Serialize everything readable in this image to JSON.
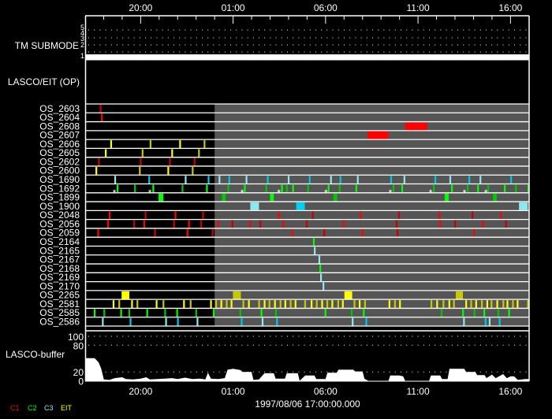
{
  "chart_data": {
    "type": "timeline",
    "title": "",
    "date_label": "1997/08/06 17:00:00.000",
    "x_range_hours": [
      0,
      24
    ],
    "x_ticks": [
      {
        "hour": 3,
        "label": "20:00"
      },
      {
        "hour": 8,
        "label": "01:00"
      },
      {
        "hour": 13,
        "label": "06:00"
      },
      {
        "hour": 18,
        "label": "11:00"
      },
      {
        "hour": 23,
        "label": "16:00"
      }
    ],
    "shaded_from_hour": 7,
    "tm_submode": {
      "label": "TM SUBMODE",
      "levels": [
        "5",
        "4",
        "3",
        "2",
        "1"
      ],
      "active_level": "1"
    },
    "op_panel_label": "LASCO/EIT (OP)",
    "rows": [
      {
        "name": "OS_2603",
        "colors": [
          "#c80000"
        ],
        "events": [
          0.83
        ]
      },
      {
        "name": "OS_2604",
        "colors": [
          "#ff0000"
        ],
        "events": [
          0.9
        ]
      },
      {
        "name": "OS_2608",
        "colors": [
          "#ff0000"
        ],
        "events": [],
        "blocks": [
          [
            17.3,
            18.5
          ]
        ]
      },
      {
        "name": "OS_2607",
        "colors": [
          "#ff0000"
        ],
        "events": [],
        "blocks": [
          [
            15.27,
            16.4
          ]
        ]
      },
      {
        "name": "OS_2606",
        "colors": [
          "#ffff00",
          "#c8c800"
        ],
        "events": [
          1.4,
          3.53,
          5.13,
          6.45
        ]
      },
      {
        "name": "OS_2605",
        "colors": [
          "#ffff00",
          "#c8c800"
        ],
        "events": [
          1.11,
          3.1,
          4.7,
          6.15
        ]
      },
      {
        "name": "OS_2602",
        "colors": [
          "#c80000"
        ],
        "events": [
          0.74,
          3.0,
          4.58,
          5.91
        ]
      },
      {
        "name": "OS_2600",
        "colors": [
          "#ffff00",
          "#c8c800"
        ],
        "events": [
          0.6,
          2.95,
          4.49,
          5.81
        ]
      },
      {
        "name": "OS_1690",
        "colors": [
          "#8ee8f0",
          "#00c8e8"
        ],
        "events": [
          1.62,
          3.46,
          5.43,
          6.67,
          7.26,
          7.79,
          8.72,
          9.87,
          11.0,
          12.14,
          13.29,
          13.8,
          14.74,
          16.54,
          17.26,
          18.93,
          19.74,
          20.77,
          21.37,
          23.03
        ]
      },
      {
        "name": "OS_1692",
        "colors": [
          "#00ff00",
          "#00c800"
        ],
        "events": [
          1.75,
          2.69,
          3.68,
          5.26,
          6.58,
          7.74,
          8.63,
          9.79,
          10.64,
          10.9,
          11.24,
          12.05,
          13.16,
          13.76,
          14.66,
          16.67,
          17.14,
          18.85,
          19.83,
          20.68,
          21.24,
          21.79,
          22.69,
          23.29,
          23.96
        ],
        "star_label": "*",
        "stars": [
          1.58,
          3.5,
          8.49,
          10.48,
          13.02,
          16.5,
          18.68,
          20.51,
          21.67
        ]
      },
      {
        "name": "OS_1899",
        "colors": [
          "#00ff00",
          "#00c800"
        ],
        "events": [],
        "blocks": [
          [
            3.97,
            4.23
          ],
          [
            7.39,
            7.6
          ],
          [
            10.0,
            10.2
          ],
          [
            13.42,
            13.63
          ],
          [
            19.44,
            19.66
          ],
          [
            22.05,
            22.26
          ]
        ]
      },
      {
        "name": "OS_1900",
        "colors": [
          "#8ee8f0",
          "#00d0f0"
        ],
        "events": [],
        "blocks": [
          [
            8.93,
            9.4
          ],
          [
            11.41,
            11.88
          ],
          [
            23.46,
            23.93
          ]
        ]
      },
      {
        "name": "OS_2048",
        "colors": [
          "#ff0000",
          "#c80000"
        ],
        "events": [
          1.32,
          3.26,
          4.88,
          6.37,
          10.47,
          12.31,
          14.9,
          16.97,
          19.15,
          20.94,
          22.48
        ]
      },
      {
        "name": "OS_2056",
        "colors": [
          "#ff0000",
          "#c80000"
        ],
        "events": [
          1.23,
          2.65,
          3.19,
          4.8,
          5.61,
          6.27,
          7.18,
          7.96,
          8.92,
          9.47,
          10.71,
          11.98,
          13.96,
          16.84,
          19.2,
          20.0,
          21.51,
          22.75
        ]
      },
      {
        "name": "OS_2059",
        "colors": [
          "#ff0000",
          "#c80000"
        ],
        "events": [
          0.7,
          3.77,
          5.53,
          6.89,
          11.2,
          12.92,
          14.99,
          16.89,
          21.02
        ]
      },
      {
        "name": "OS_2164",
        "colors": [
          "#00ff00"
        ],
        "events": [
          12.36
        ]
      },
      {
        "name": "OS_2165",
        "colors": [
          "#8ee8f0"
        ],
        "events": [
          12.41
        ]
      },
      {
        "name": "OS_2167",
        "colors": [
          "#8ee8f0"
        ],
        "events": [
          12.66
        ]
      },
      {
        "name": "OS_2168",
        "colors": [
          "#00ff00"
        ],
        "events": [
          12.71
        ]
      },
      {
        "name": "OS_2169",
        "colors": [
          "#8ee8f0"
        ],
        "events": [
          12.75
        ]
      },
      {
        "name": "OS_2170",
        "colors": [
          "#8ee8f0"
        ],
        "events": [
          12.88
        ]
      },
      {
        "name": "OS_2265",
        "colors": [
          "#ffff00",
          "#c8c800"
        ],
        "events": [],
        "blocks": [
          [
            1.97,
            2.39
          ],
          [
            7.99,
            8.42
          ],
          [
            14.02,
            14.44
          ],
          [
            20.04,
            20.43
          ]
        ]
      },
      {
        "name": "OS_2581",
        "colors": [
          "#ffff00",
          "#c8c800"
        ],
        "events": [
          1.53,
          1.84,
          2.53,
          2.82,
          3.86,
          4.23,
          5.34,
          5.7,
          6.8,
          7.08,
          7.36,
          7.65,
          7.91,
          8.55,
          8.85,
          9.4,
          9.7,
          9.96,
          10.26,
          10.56,
          10.82,
          11.11,
          11.37,
          11.89,
          12.24,
          12.52,
          12.81,
          13.09,
          13.36,
          13.68,
          13.93,
          14.56,
          14.84,
          15.13,
          16.45,
          16.75,
          17.02,
          18.72,
          19.03,
          19.37,
          19.69,
          19.94,
          20.6,
          20.87,
          21.14,
          21.45,
          21.74,
          21.97,
          22.28,
          22.61,
          22.83,
          23.13,
          23.38,
          23.94
        ]
      },
      {
        "name": "OS_2585",
        "colors": [
          "#00ff00",
          "#00c800"
        ],
        "events": [
          0.51,
          1.03,
          1.94,
          2.38,
          3.35,
          4.32,
          4.97,
          6.0,
          6.95,
          8.39,
          9.53,
          10.31,
          12.99,
          14.41,
          15.06,
          19.27,
          20.43,
          21.05,
          21.58,
          22.34,
          22.92
        ]
      },
      {
        "name": "OS_2586",
        "colors": [
          "#8ee8f0",
          "#00c8e8"
        ],
        "events": [
          0.95,
          2.45,
          4.37,
          5.01,
          6.07,
          8.46,
          9.59,
          10.37,
          14.46,
          15.2,
          20.48,
          21.65,
          21.87,
          22.41
        ]
      }
    ],
    "buffer": {
      "label": "LASCO-buffer",
      "ylim": [
        0,
        100
      ],
      "y_ticks": [
        "100",
        "80",
        "20",
        "0"
      ],
      "y_tick_values": [
        100,
        80,
        20,
        0
      ],
      "grid_values": [
        100,
        80,
        20
      ],
      "points": [
        [
          0,
          51
        ],
        [
          0.5,
          51
        ],
        [
          0.6,
          47
        ],
        [
          0.73,
          41
        ],
        [
          0.87,
          27
        ],
        [
          1.01,
          3
        ],
        [
          1.3,
          2
        ],
        [
          1.6,
          6
        ],
        [
          2.0,
          8
        ],
        [
          2.2,
          4
        ],
        [
          2.6,
          3
        ],
        [
          3.0,
          5
        ],
        [
          3.3,
          8
        ],
        [
          3.5,
          3
        ],
        [
          3.9,
          4
        ],
        [
          4.3,
          5
        ],
        [
          4.7,
          6
        ],
        [
          5.0,
          4
        ],
        [
          5.4,
          7
        ],
        [
          5.8,
          4
        ],
        [
          6.2,
          5
        ],
        [
          6.5,
          3
        ],
        [
          6.64,
          18
        ],
        [
          6.8,
          5
        ],
        [
          7.2,
          4
        ],
        [
          7.55,
          6
        ],
        [
          7.7,
          25
        ],
        [
          8.0,
          27
        ],
        [
          8.4,
          24
        ],
        [
          8.5,
          20
        ],
        [
          9.0,
          20
        ],
        [
          9.1,
          2
        ],
        [
          9.4,
          3
        ],
        [
          9.55,
          10
        ],
        [
          9.7,
          17
        ],
        [
          10.2,
          17
        ],
        [
          10.3,
          5
        ],
        [
          10.8,
          5
        ],
        [
          10.9,
          17
        ],
        [
          11.5,
          17
        ],
        [
          11.6,
          0
        ],
        [
          11.9,
          12
        ],
        [
          12.4,
          12
        ],
        [
          12.5,
          4
        ],
        [
          13.0,
          4
        ],
        [
          13.1,
          18
        ],
        [
          13.6,
          18
        ],
        [
          13.7,
          25
        ],
        [
          14.5,
          25
        ],
        [
          14.6,
          21
        ],
        [
          15.0,
          21
        ],
        [
          15.1,
          5
        ],
        [
          15.3,
          0
        ],
        [
          16.4,
          0
        ],
        [
          16.5,
          12
        ],
        [
          17.0,
          12
        ],
        [
          17.2,
          10
        ],
        [
          17.3,
          0
        ],
        [
          18.6,
          0
        ],
        [
          18.7,
          12
        ],
        [
          19.2,
          12
        ],
        [
          19.3,
          4
        ],
        [
          19.6,
          4
        ],
        [
          19.7,
          27
        ],
        [
          20.5,
          27
        ],
        [
          20.6,
          20
        ],
        [
          21.1,
          20
        ],
        [
          21.2,
          13
        ],
        [
          21.6,
          13
        ],
        [
          21.7,
          6
        ],
        [
          22.0,
          14
        ],
        [
          22.2,
          6
        ],
        [
          22.6,
          15
        ],
        [
          22.8,
          6
        ],
        [
          23.0,
          10
        ],
        [
          23.2,
          10
        ],
        [
          23.4,
          2
        ],
        [
          23.8,
          4
        ],
        [
          24,
          4
        ]
      ]
    },
    "legend": [
      {
        "label": "C1",
        "color": "#ff0000"
      },
      {
        "label": "C2",
        "color": "#00ff00"
      },
      {
        "label": "C3",
        "color": "#8ee8f0"
      },
      {
        "label": "EIT",
        "color": "#ffff00"
      }
    ]
  }
}
